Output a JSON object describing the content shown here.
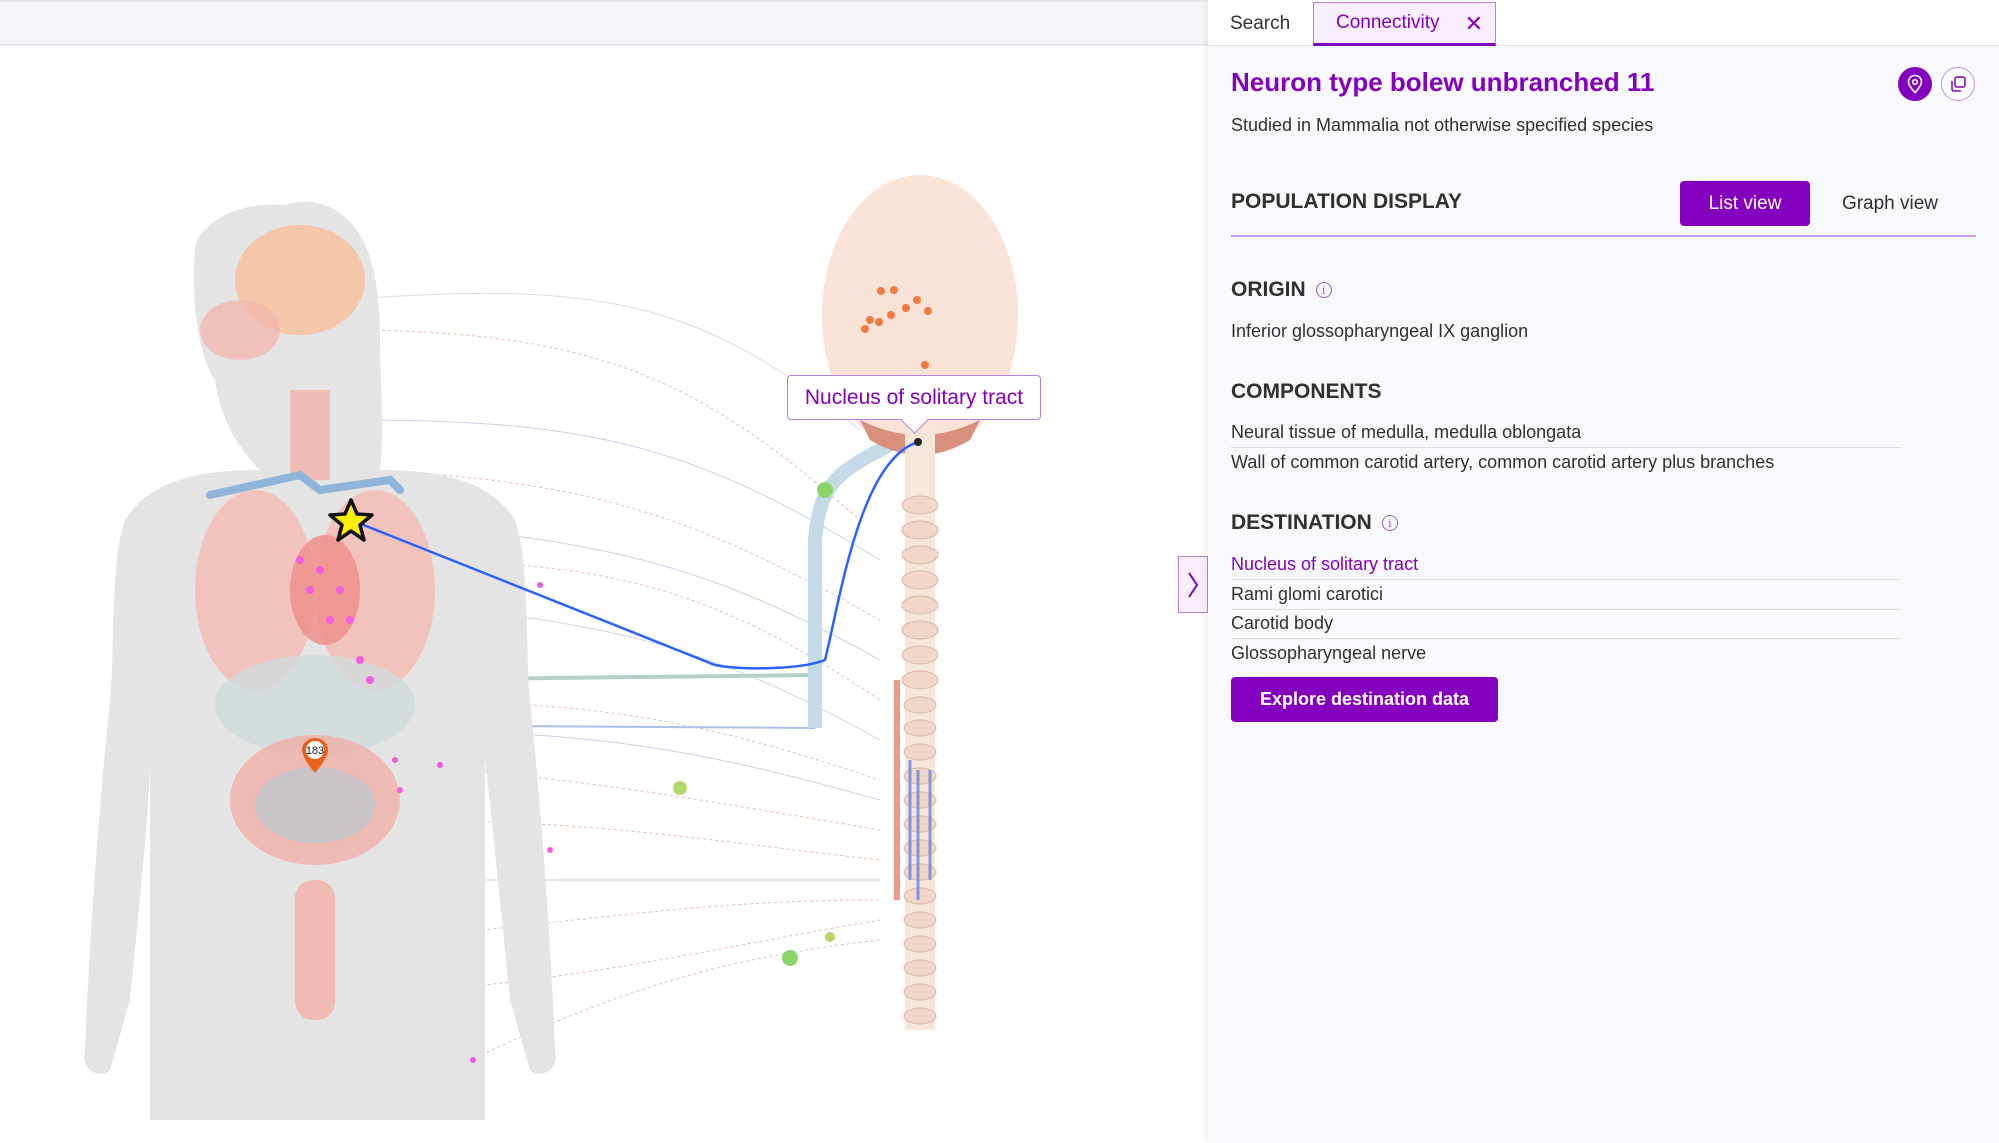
{
  "tabs": {
    "search_label": "Search",
    "connectivity_label": "Connectivity",
    "close_glyph": "✕"
  },
  "map": {
    "tooltip_label": "Nucleus of solitary tract",
    "marker_count": "183",
    "collapse_glyph": "〉",
    "colors": {
      "highlight_path": "#2962ff",
      "star_fill": "#ffee00",
      "marker": "#e8621a",
      "body": "#e3e3e3",
      "organ": "#f2b7b0"
    }
  },
  "panel": {
    "title": "Neuron type bolew unbranched 11",
    "subtitle": "Studied in Mammalia not otherwise specified species",
    "population_display": {
      "heading": "POPULATION DISPLAY",
      "list_view_label": "List view",
      "graph_view_label": "Graph view",
      "selected": "List view"
    },
    "origin": {
      "heading": "ORIGIN",
      "items": [
        "Inferior glossopharyngeal IX ganglion"
      ]
    },
    "components": {
      "heading": "COMPONENTS",
      "items": [
        "Neural tissue of medulla, medulla oblongata",
        "Wall of common carotid artery, common carotid artery plus branches"
      ]
    },
    "destination": {
      "heading": "DESTINATION",
      "items": [
        "Nucleus of solitary tract",
        "Rami glomi carotici",
        "Carotid body",
        "Glossopharyngeal nerve"
      ],
      "explore_label": "Explore destination data"
    },
    "accent_color": "#8300bf"
  }
}
